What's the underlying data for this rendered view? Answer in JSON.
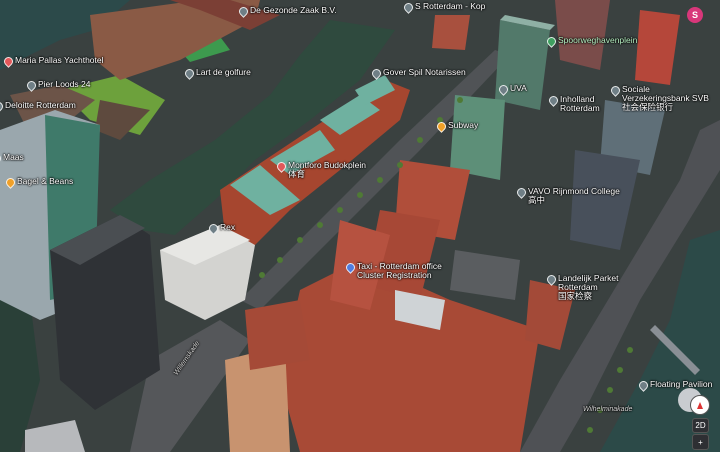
{
  "map": {
    "view": "3D satellite",
    "place_labels": [
      {
        "text": "De Gezonde Zaak B.V.",
        "pin": "grey"
      },
      {
        "text": "S Rotterdam - Kop",
        "pin": "grey"
      },
      {
        "text": "Spoorweghavenplein",
        "pin": "green"
      },
      {
        "text": "Maria Pallas Yachthotel",
        "pin": "red"
      },
      {
        "text": "Pier Loods 24",
        "pin": "grey"
      },
      {
        "text": "Lart de golfure",
        "pin": "grey"
      },
      {
        "text": "Gover Spil Notarissen",
        "pin": "grey"
      },
      {
        "text": "UVA",
        "pin": "grey"
      },
      {
        "text": "Sociale\nVerzekeringsbank SVB\n社会保险银行",
        "pin": "grey"
      },
      {
        "text": "Deloitte Rotterdam",
        "pin": "grey"
      },
      {
        "text": "Inholland\nRotterdam",
        "pin": "grey"
      },
      {
        "text": "Subway",
        "pin": "orange"
      },
      {
        "text": "Maas",
        "pin": "grey"
      },
      {
        "text": "Montforo Budokplein\n体育",
        "pin": "red"
      },
      {
        "text": "Bagel & Beans",
        "pin": "orange"
      },
      {
        "text": "VAVO Rijnmond College\n高中",
        "pin": "grey"
      },
      {
        "text": "Rex",
        "pin": "grey"
      },
      {
        "text": "Taxi - Rotterdam office\nCluster Registration",
        "pin": "blue"
      },
      {
        "text": "Landelijk Parket\nRotterdam\n国家检察",
        "pin": "grey"
      },
      {
        "text": "Floating Pavilion",
        "pin": "grey"
      },
      {
        "text": "Wilhelminakade",
        "pin": "none"
      },
      {
        "text": "Willemskade",
        "pin": "none"
      }
    ],
    "controls": {
      "profile_initial": "S",
      "compass": "",
      "mode_2d": "2D",
      "zoom_in": "+",
      "zoom_out": "−"
    },
    "colors": {
      "water": "#2f4a3e",
      "brick": "#a6462f",
      "grass": "#6da13c",
      "road": "#4f5155",
      "pin_grey": "#6f7f86",
      "pin_red": "#e2585a",
      "pin_orange": "#f0a028",
      "pin_blue": "#4f7de0"
    }
  }
}
